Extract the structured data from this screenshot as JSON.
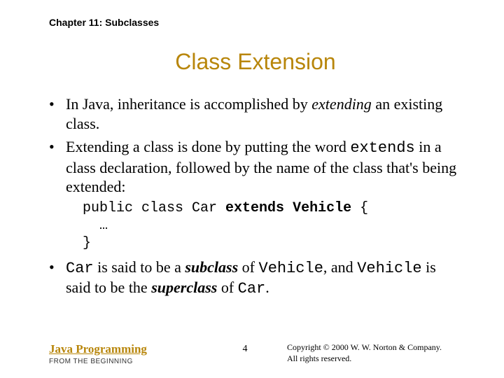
{
  "chapter_label": "Chapter 11: Subclasses",
  "title": "Class Extension",
  "bullet1": {
    "pre": "In Java, inheritance is accomplished by ",
    "em": "extending",
    "post": " an existing class."
  },
  "bullet2": {
    "pre": "Extending a class is done by putting the word ",
    "code": "extends",
    "post": " in a class declaration, followed by the name of the class that's being extended:"
  },
  "code": {
    "line1_a": "public class Car ",
    "line1_b": "extends Vehicle",
    "line1_c": " {",
    "line2": "  …",
    "line3": "}"
  },
  "bullet3": {
    "c1": "Car",
    "t1": " is said to be a ",
    "e1": "subclass",
    "t2": " of ",
    "c2": "Vehicle",
    "t3": ", and ",
    "c3": "Vehicle",
    "t4": " is said to be the ",
    "e2": "superclass",
    "t5": " of ",
    "c4": "Car",
    "t6": "."
  },
  "footer": {
    "book_title": "Java Programming",
    "book_sub": "FROM THE BEGINNING",
    "page_number": "4",
    "copyright_line1": "Copyright © 2000 W. W. Norton & Company.",
    "copyright_line2": "All rights reserved."
  }
}
